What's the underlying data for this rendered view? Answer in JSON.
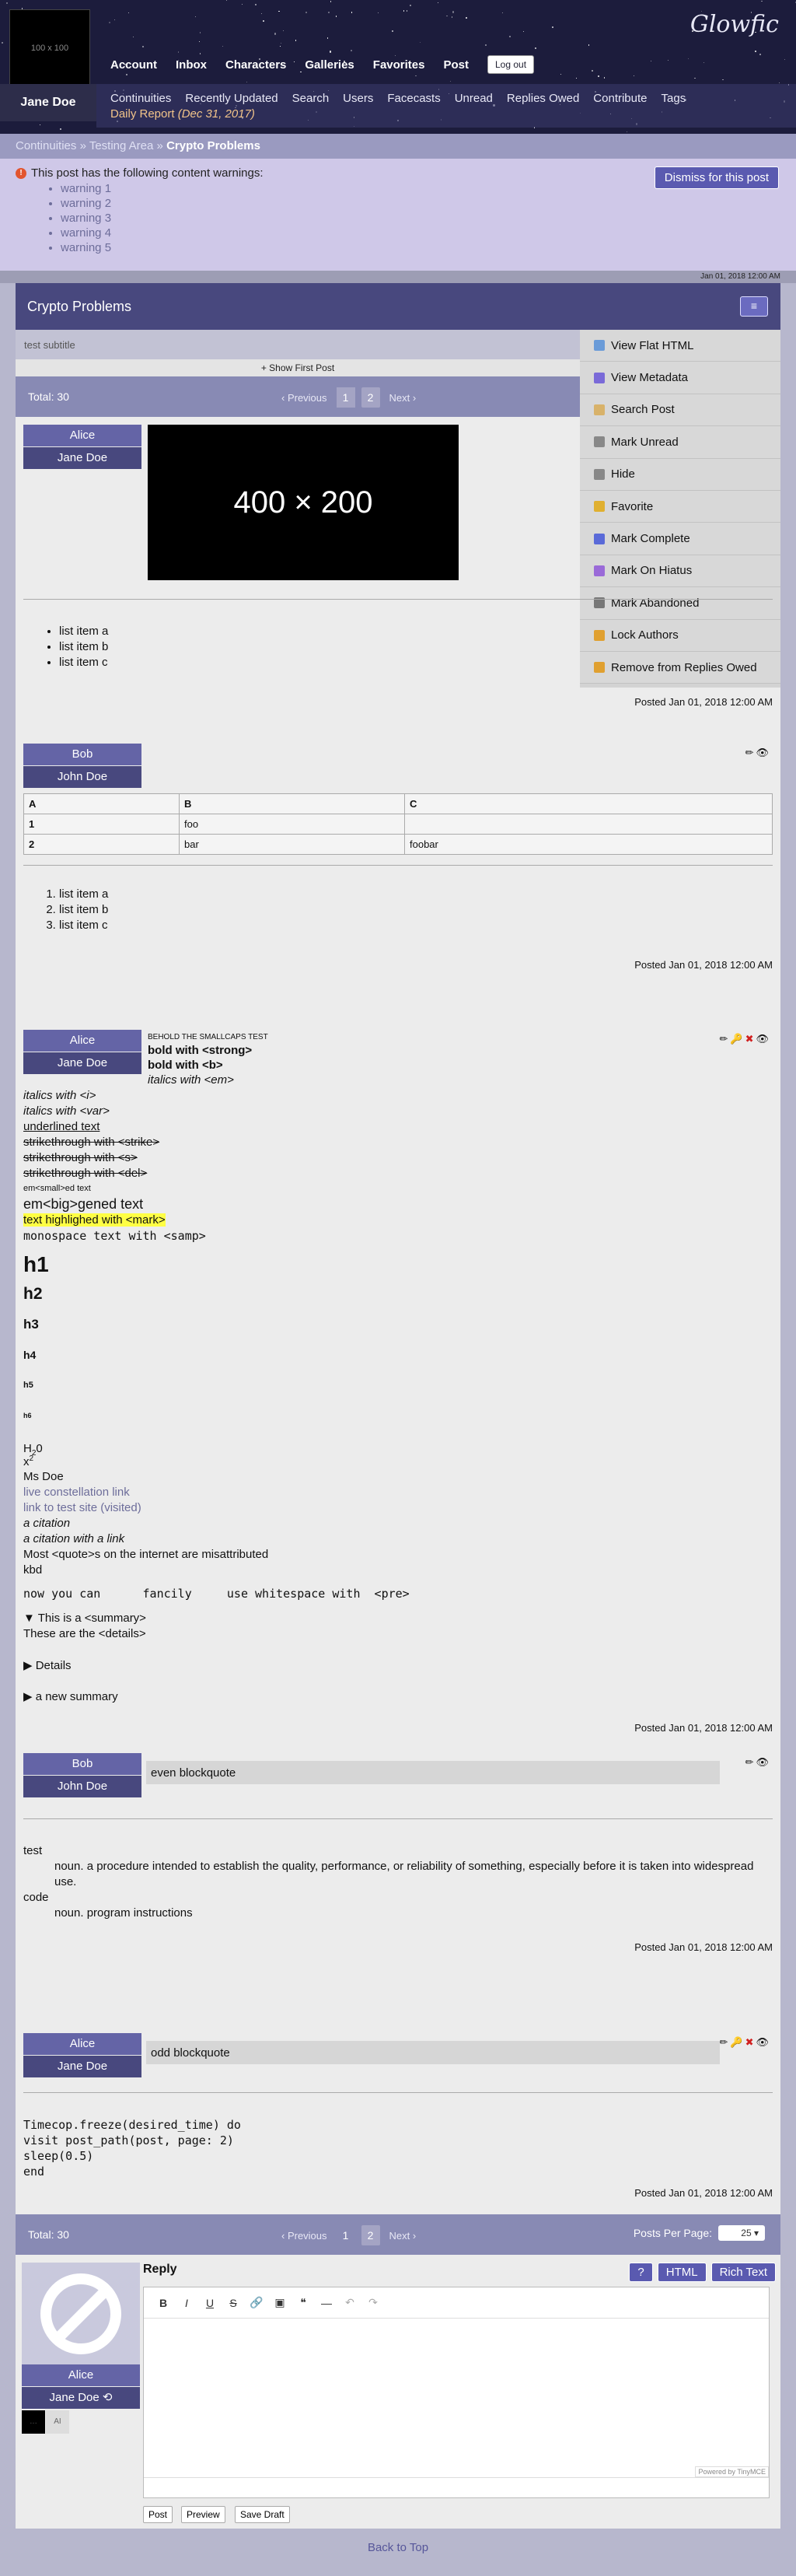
{
  "header": {
    "logo": "Glowfic",
    "avatar_text": "100 x 100",
    "username": "Jane Doe",
    "nav": [
      "Account",
      "Inbox",
      "Characters",
      "Galleries",
      "Favorites",
      "Post"
    ],
    "logout": "Log out",
    "subnav": [
      "Continuities",
      "Recently Updated",
      "Search",
      "Users",
      "Facecasts",
      "Unread",
      "Replies Owed",
      "Contribute",
      "Tags"
    ],
    "daily_report": "Daily Report",
    "daily_date": "(Dec 31, 2017)"
  },
  "breadcrumb": {
    "continuities": "Continuities",
    "sep": "»",
    "area": "Testing Area",
    "current": "Crypto Problems"
  },
  "warnings": {
    "title": "This post has the following content warnings:",
    "items": [
      "warning 1",
      "warning 2",
      "warning 3",
      "warning 4",
      "warning 5"
    ],
    "dismiss": "Dismiss for this post"
  },
  "last_date": "Jan 01, 2018 12:00 AM",
  "post": {
    "title": "Crypto Problems",
    "subtitle": "test subtitle",
    "show_first": "+ Show First Post"
  },
  "pager": {
    "total": "Total: 30",
    "prev": "‹ Previous",
    "pages": [
      "1",
      "2"
    ],
    "current": "2",
    "next": "Next ›",
    "per_page_label": "Posts Per Page:",
    "per_page": "25"
  },
  "menu": [
    "View Flat HTML",
    "View Metadata",
    "Search Post",
    "Mark Unread",
    "Hide",
    "Favorite",
    "Mark Complete",
    "Mark On Hiatus",
    "Mark Abandoned",
    "Lock Authors",
    "Remove from Replies Owed"
  ],
  "menu_colors": [
    "#6a9bd8",
    "#7a6ad8",
    "#d8b26a",
    "#888888",
    "#888888",
    "#e0b030",
    "#5a6ad8",
    "#9a6ad8",
    "#777777",
    "#e0a030",
    "#e0a030"
  ],
  "posted": "Posted Jan 01, 2018 12:00 AM",
  "p1": {
    "char": "Alice",
    "user": "Jane Doe",
    "image_text": "400 × 200",
    "list": [
      "list item a",
      "list item b",
      "list item c"
    ]
  },
  "p2": {
    "char": "Bob",
    "user": "John Doe",
    "table": [
      [
        "A",
        "B",
        "C"
      ],
      [
        "1",
        "foo",
        ""
      ],
      [
        "2",
        "bar",
        "foobar"
      ]
    ],
    "list": [
      "list item a",
      "list item b",
      "list item c"
    ]
  },
  "p3": {
    "char": "Alice",
    "user": "Jane Doe",
    "smallcaps": "BEHOLD THE SMALLCAPS TEST",
    "strong": "bold with <strong>",
    "b": "bold with <b>",
    "em": "italics with <em>",
    "i": "italics with <i>",
    "var": "italics with <var>",
    "u": "underlined text",
    "strike": "strikethrough with <strike>",
    "s": "strikethrough with <s>",
    "del": "strikethrough with <del>",
    "small": "em<small>ed text",
    "big": "em<big>gened text",
    "mark": "text highlighed with <mark>",
    "samp": "monospace text with <samp>",
    "h1": "h1",
    "h2": "h2",
    "h3": "h3",
    "h4": "h4",
    "h5": "h5",
    "h6": "h6",
    "sub_base": "H",
    "sub": "2",
    "sub_after": "0",
    "sup_base": "x",
    "sup": "2",
    "msdoe": "Ms Doe",
    "link1": "live constellation link",
    "link2": "link to test site (visited)",
    "cite": "a citation",
    "cite_link": "a citation with a link",
    "quote": "Most <quote>s on the internet are misattributed",
    "kbd": "kbd",
    "pre": "now you can      fancily     use whitespace with  <pre>",
    "summary": "▼ This is a <summary>",
    "details_body": "These are the <details>",
    "details": "▶ Details",
    "new_summary": "▶ a new summary"
  },
  "p4": {
    "char": "Bob",
    "user": "John Doe",
    "blockquote": "even blockquote",
    "dl": [
      {
        "term": "test",
        "def": "noun. a procedure intended to establish the quality, performance, or reliability of something, especially before it is taken into widespread use."
      },
      {
        "term": "code",
        "def": "noun. program instructions"
      }
    ]
  },
  "p5": {
    "char": "Alice",
    "user": "Jane Doe",
    "blockquote": "odd blockquote",
    "code": [
      "Timecop.freeze(desired_time) do",
      "visit post_path(post, page: 2)",
      "sleep(0.5)",
      "end"
    ]
  },
  "reply": {
    "title": "Reply",
    "char": "Alice",
    "user": "Jane Doe",
    "help": "?",
    "html": "HTML",
    "rich": "Rich Text",
    "powered": "Powered by TinyMCE",
    "post": "Post",
    "preview": "Preview",
    "draft": "Save Draft",
    "ai": "AI"
  },
  "back_to_top": "Back to Top"
}
